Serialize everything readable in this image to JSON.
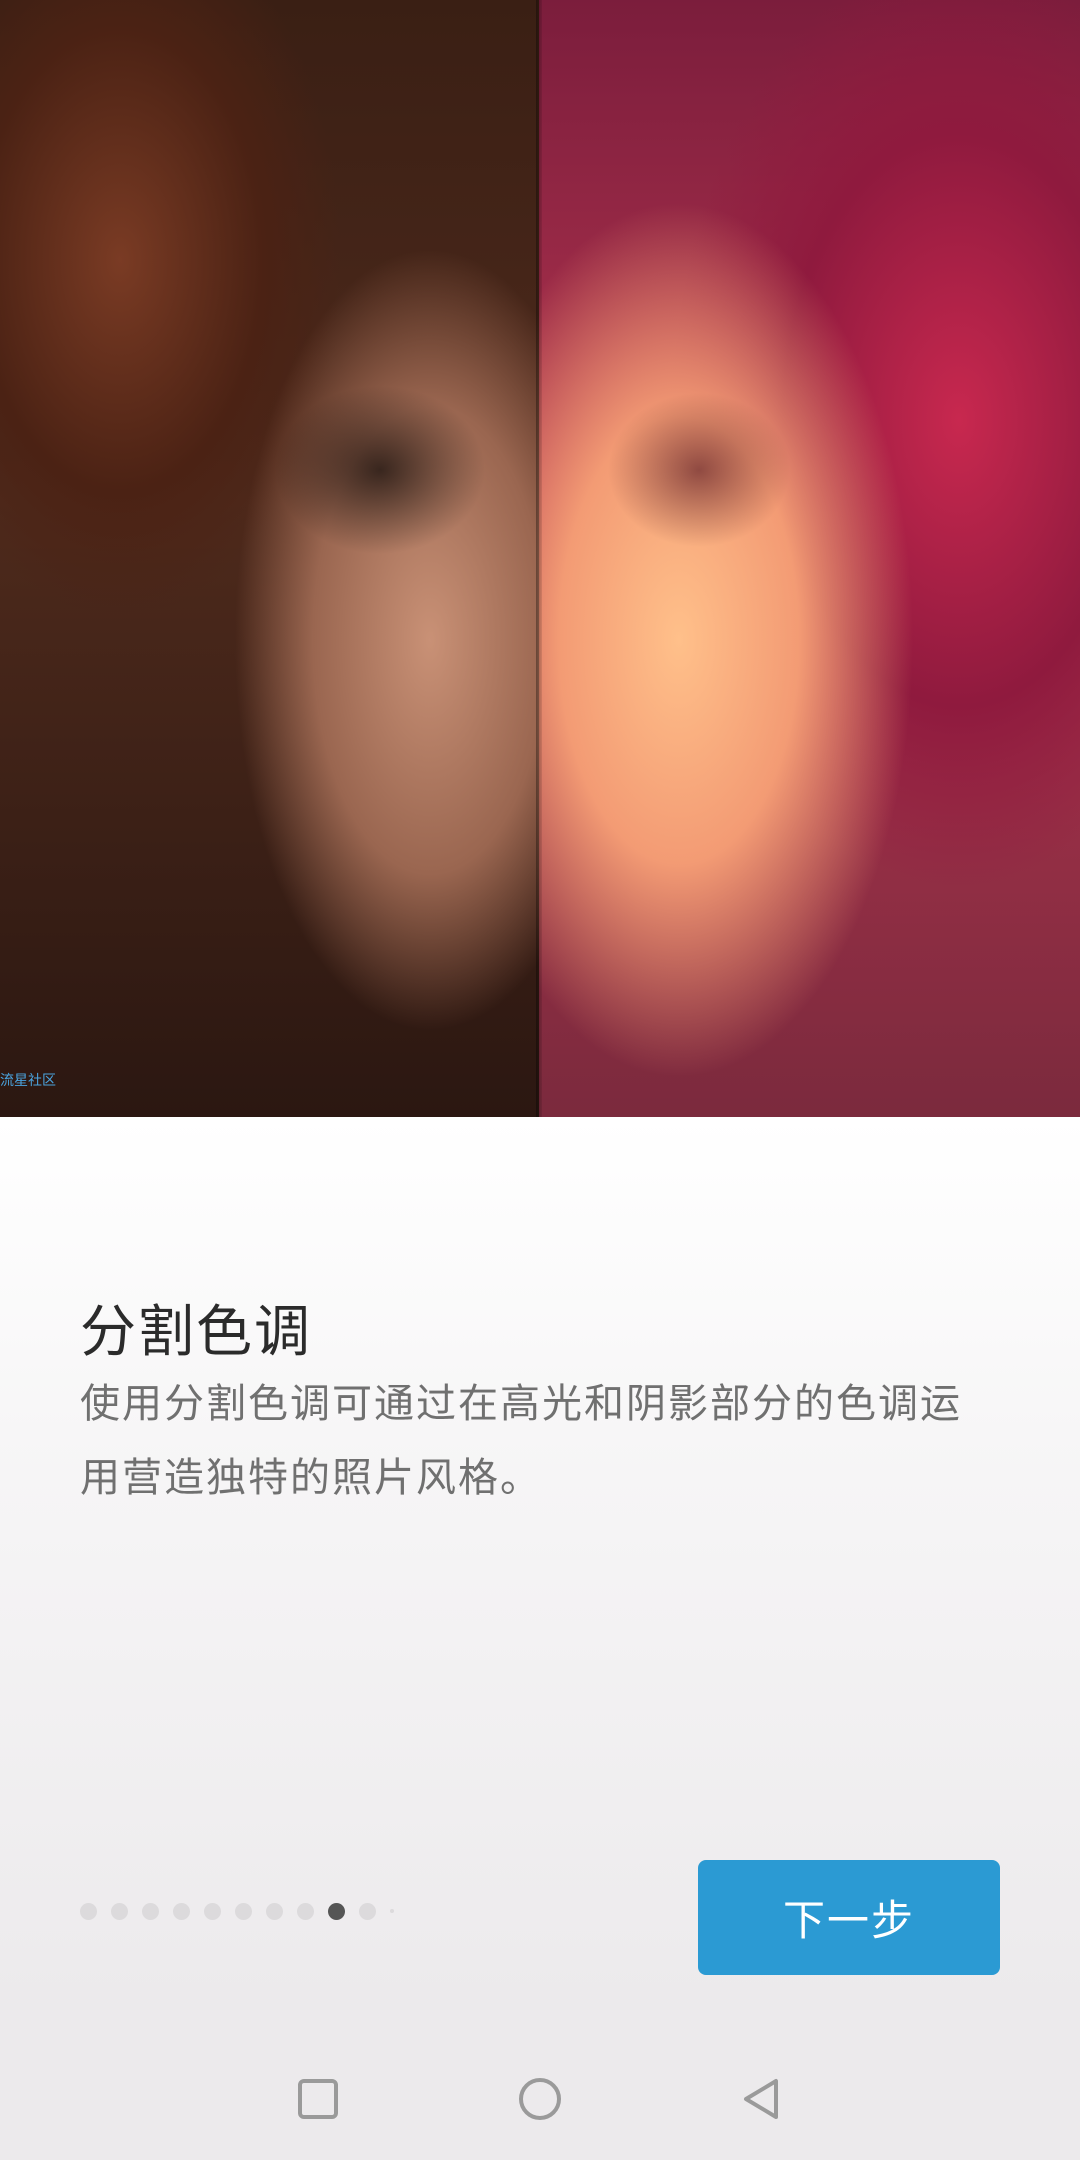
{
  "hero": {
    "watermark": "流星社区"
  },
  "intro": {
    "title": "分割色调",
    "description": "使用分割色调可通过在高光和阴影部分的色调运用营造独特的照片风格。"
  },
  "pager": {
    "total_dots": 10,
    "active_index": 8
  },
  "next_button": {
    "label": "下一步"
  },
  "nav": {
    "recents_icon": "square-icon",
    "home_icon": "circle-icon",
    "back_icon": "triangle-back-icon"
  },
  "colors": {
    "accent": "#2b9ad3",
    "dot_active": "#555555",
    "dot_inactive": "#dcdadc"
  }
}
